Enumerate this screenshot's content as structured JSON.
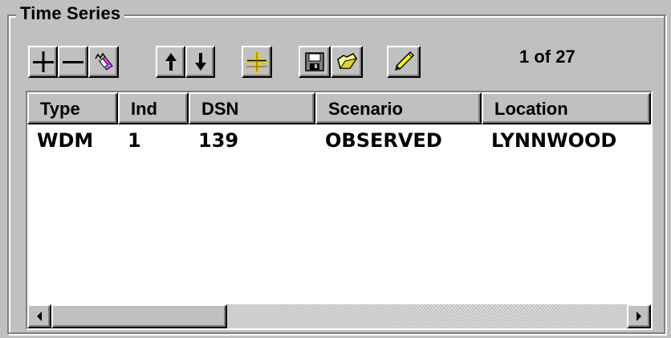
{
  "group": {
    "title": "Time Series"
  },
  "toolbar": {
    "buttons": [
      {
        "name": "add",
        "icon": "plus-icon"
      },
      {
        "name": "remove",
        "icon": "minus-icon"
      },
      {
        "name": "clear",
        "icon": "eraser-icon"
      },
      {
        "name": "move-up",
        "icon": "arrow-up-icon"
      },
      {
        "name": "move-down",
        "icon": "arrow-down-icon"
      },
      {
        "name": "columns",
        "icon": "column-divider-icon"
      },
      {
        "name": "save",
        "icon": "floppy-disk-icon"
      },
      {
        "name": "open",
        "icon": "folder-icon"
      },
      {
        "name": "edit",
        "icon": "pencil-icon"
      }
    ],
    "counter": "1 of 27"
  },
  "grid": {
    "columns": [
      "Type",
      "Ind",
      "DSN",
      "Scenario",
      "Location"
    ],
    "rows": [
      [
        "WDM",
        "1",
        "139",
        "OBSERVED",
        "LYNNWOOD"
      ]
    ]
  },
  "colors": {
    "face": "#c0c0c0",
    "highlight": "#ffffff",
    "shadow": "#808080",
    "dark": "#000000",
    "pencil": "#ffff00",
    "folder": "#ffff80"
  }
}
